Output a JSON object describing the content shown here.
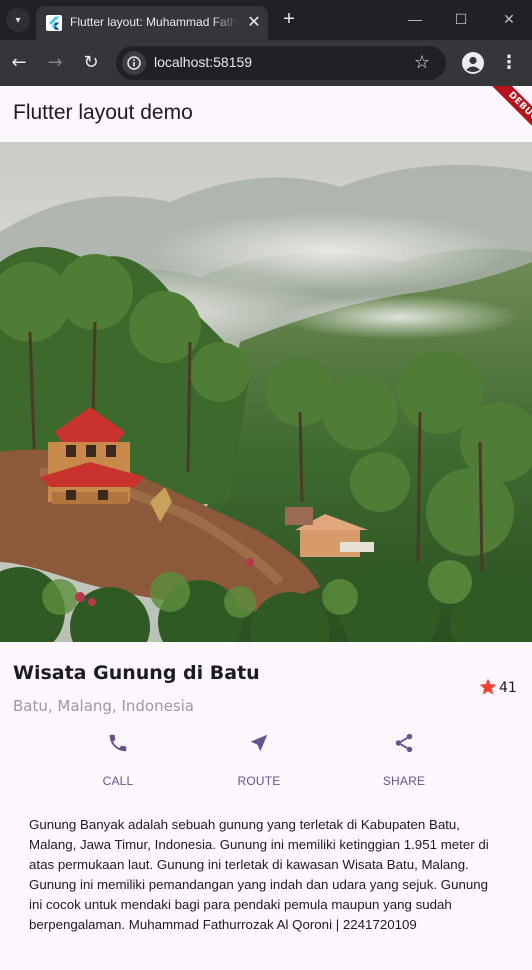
{
  "browser": {
    "tab_title": "Flutter layout: Muhammad Fathurrozak Al Qoroni",
    "url": "localhost:58159",
    "new_tab_symbol": "+",
    "close_symbol": "✕",
    "minimize_symbol": "—",
    "maximize_symbol": "☐",
    "window_close_symbol": "✕"
  },
  "app": {
    "title": "Flutter layout demo",
    "debug_banner": "DEBUG"
  },
  "place": {
    "name": "Wisata Gunung di Batu",
    "location": "Batu, Malang, Indonesia",
    "rating": "41"
  },
  "actions": [
    {
      "label": "CALL",
      "icon": "phone-icon"
    },
    {
      "label": "ROUTE",
      "icon": "navigation-icon"
    },
    {
      "label": "SHARE",
      "icon": "share-icon"
    }
  ],
  "description": "Gunung Banyak adalah sebuah gunung yang terletak di Kabupaten Batu, Malang, Jawa Timur, Indonesia. Gunung ini memiliki ketinggian 1.951 meter di atas permukaan laut. Gunung ini terletak di kawasan Wisata Batu, Malang. Gunung ini memiliki pemandangan yang indah dan udara yang sejuk. Gunung ini cocok untuk mendaki bagi para pendaki pemula maupun yang sudah berpengalaman. Muhammad Fathurrozak Al Qoroni | 2241720109",
  "colors": {
    "accent": "#65558f",
    "star": "#f44336",
    "background": "#fdf7fe"
  }
}
